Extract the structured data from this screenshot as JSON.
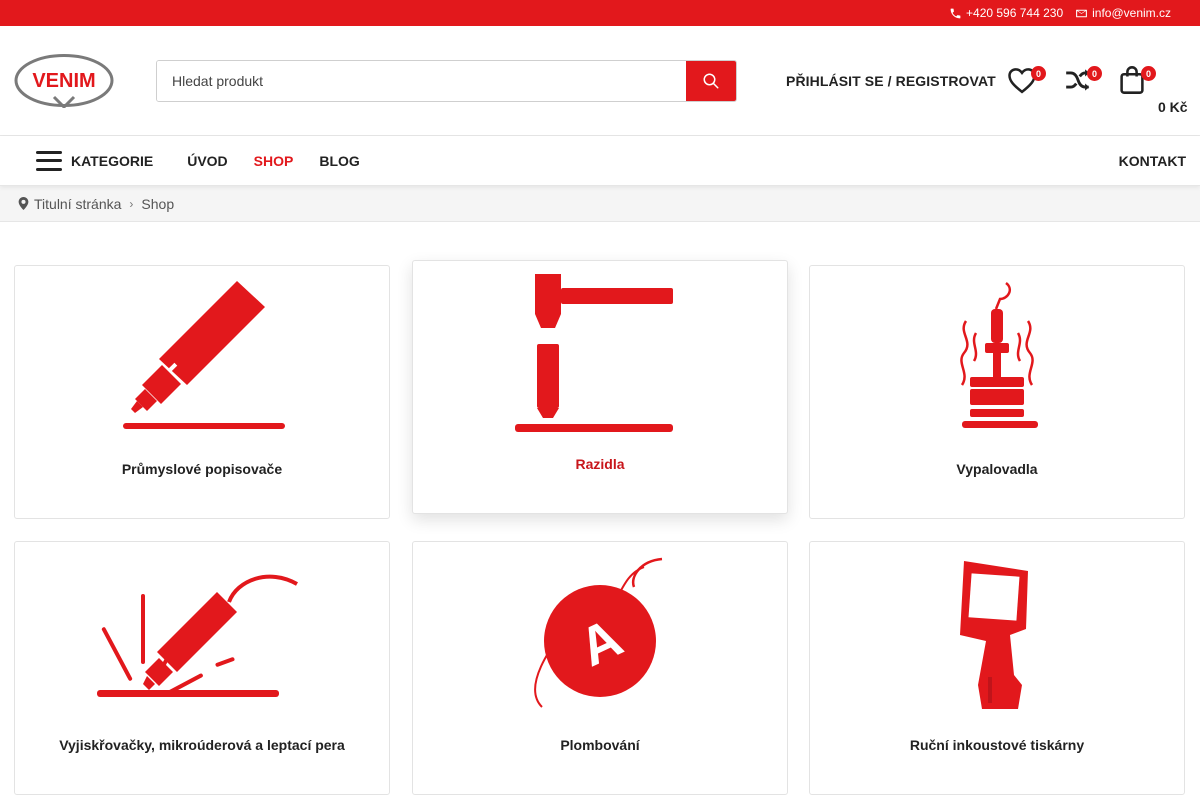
{
  "topbar": {
    "phone": "+420 596 744 230",
    "email": "info@venim.cz"
  },
  "header": {
    "logo_text": "VENIM",
    "search_placeholder": "Hledat produkt",
    "login_label": "PŘIHLÁSIT SE / REGISTROVAT",
    "wishlist_count": "0",
    "compare_count": "0",
    "cart_count": "0",
    "cart_total": "0 Kč"
  },
  "nav": {
    "categories_label": "KATEGORIE",
    "links": [
      "ÚVOD",
      "SHOP",
      "BLOG"
    ],
    "active": "SHOP",
    "contact_label": "KONTAKT"
  },
  "breadcrumb": {
    "home": "Titulní stránka",
    "current": "Shop"
  },
  "categories": [
    {
      "label": "Průmyslové popisovače",
      "icon": "marker-icon"
    },
    {
      "label": "Razidla",
      "icon": "stamp-icon"
    },
    {
      "label": "Vypalovadla",
      "icon": "branding-iron-icon"
    },
    {
      "label": "Vyjiskřovačky, mikroúderová a leptací pera",
      "icon": "engraving-pen-icon"
    },
    {
      "label": "Plombování",
      "icon": "seal-icon"
    },
    {
      "label": "Ruční inkoustové tiskárny",
      "icon": "handheld-printer-icon"
    }
  ],
  "colors": {
    "brand_red": "#e2181c"
  }
}
